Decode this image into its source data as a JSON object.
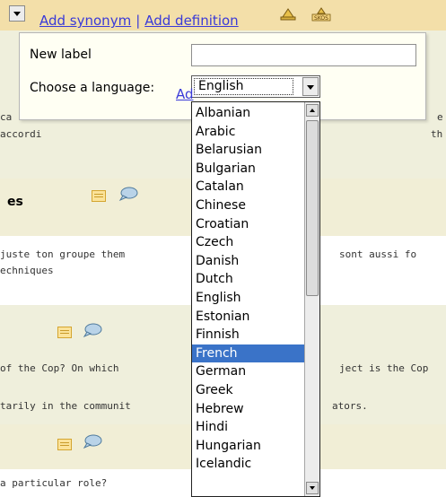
{
  "header": {
    "add_synonym": "Add synonym",
    "separator": "|",
    "add_definition": "Add definition",
    "icons": [
      "hat-icon",
      "skos-icon"
    ],
    "skos_label": "SKOS"
  },
  "popup": {
    "new_label_label": "New label",
    "new_label_value": "",
    "choose_language_label": "Choose a language:",
    "selected_language": "English",
    "add_link": "Ad"
  },
  "dropdown": {
    "options": [
      "Albanian",
      "Arabic",
      "Belarusian",
      "Bulgarian",
      "Catalan",
      "Chinese",
      "Croatian",
      "Czech",
      "Danish",
      "Dutch",
      "English",
      "Estonian",
      "Finnish",
      "French",
      "German",
      "Greek",
      "Hebrew",
      "Hindi",
      "Hungarian",
      "Icelandic"
    ],
    "highlighted": "French",
    "highlight_color": "#3a73c8"
  },
  "background": {
    "s1_a": "ca",
    "s1_b": "accordi",
    "s1_c": "e",
    "s1_d": "th",
    "s2_heading": "es",
    "s3_a": "juste ton groupe them",
    "s3_b": "sont aussi fo",
    "s3_c": "echniques",
    "s4_a": "of the Cop? On which",
    "s4_b": "ject is the Cop",
    "s4_c": "tarily in the communit",
    "s4_d": "ators.",
    "s5_a": "a particular role?",
    "colors": {
      "header": "#f3dfa9",
      "section": "#efefdc",
      "link": "#3a3ad8"
    }
  }
}
